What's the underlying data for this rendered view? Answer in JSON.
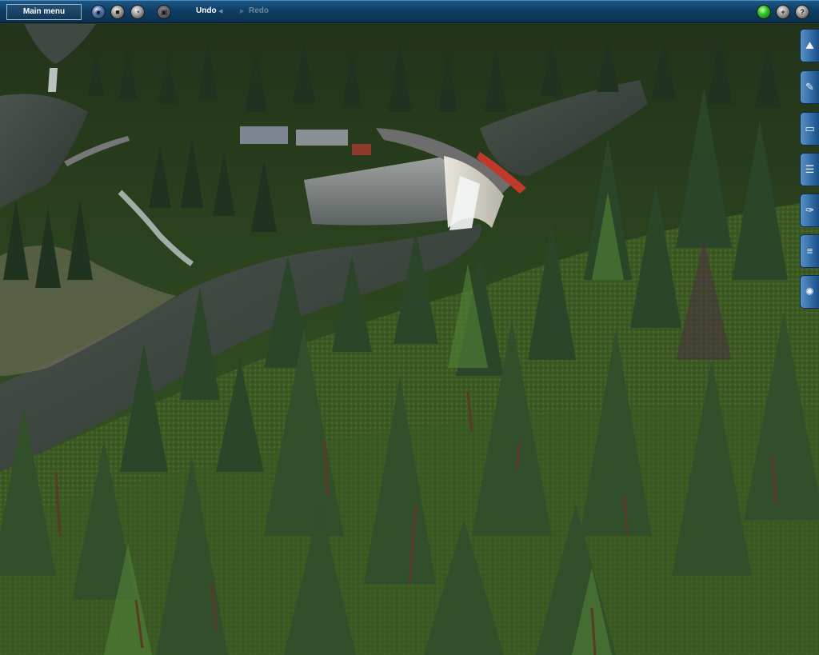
{
  "toolbar": {
    "main_menu_label": "Main menu",
    "undo_label": "Undo",
    "redo_label": "Redo",
    "left_icons": [
      "globe-icon",
      "stop-icon",
      "clock-icon",
      "camera-icon"
    ],
    "right_icons": [
      "status-light-icon",
      "add-icon",
      "help-icon"
    ]
  },
  "sidebar": {
    "tools": [
      "terrain-tool-icon",
      "paint-tool-icon",
      "objects-tool-icon",
      "track-tool-icon",
      "wrench-tool-icon",
      "layers-tool-icon",
      "settings-tool-icon"
    ]
  },
  "colors": {
    "toolbar_blue": "#0f3f66",
    "sidebar_blue": "#2f6aa6",
    "forest_green": "#2f4a1f",
    "water": "#3e4740"
  }
}
